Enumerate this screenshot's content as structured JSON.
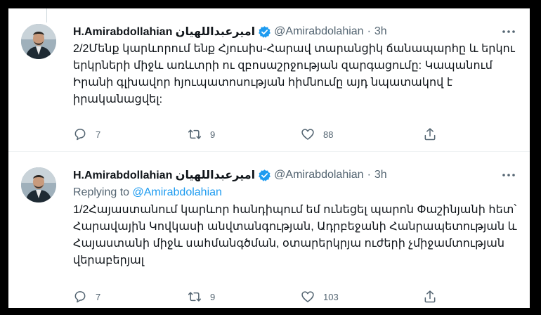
{
  "colors": {
    "accent": "#1d9bf0",
    "secondary_text": "#536471",
    "primary_text": "#0f1419"
  },
  "tweets": [
    {
      "name": "H.Amirabdollahian امیرعبداللهیان",
      "handle": "@Amirabdolahian",
      "separator": "·",
      "time": "3h",
      "replying_label": "",
      "replying_handle": "",
      "text": "2/2Մենք կարևորում ենք Հյուսիս-Հարավ տարանցիկ ճանապարհը և երկու երկրների միջև առևտրի ու զբոսաշրջության զարգացումը: Կապանում Իրանի գլխավոր հյուպատոսության հիմնումը այդ նպատակով է իրականացվել:",
      "replies": "7",
      "retweets": "9",
      "likes": "88"
    },
    {
      "name": "H.Amirabdollahian امیرعبداللهیان",
      "handle": "@Amirabdolahian",
      "separator": "·",
      "time": "3h",
      "replying_label": "Replying to ",
      "replying_handle": "@Amirabdolahian",
      "text": "1/2Հայաստանում կարևոր հանդիպում եմ ունեցել պարոն Փաշինյանի հետ՝ Հարավային Կովկասի անվտանգության, Ադրբեջանի Հանրապետության և Հայաստանի միջև սահմանգծման, օտարերկրյա ուժերի չմիջամտության վերաբերյալ",
      "replies": "7",
      "retweets": "9",
      "likes": "103"
    }
  ],
  "icons": {
    "verified": "verified-badge-icon",
    "more": "more-dots-icon",
    "reply": "reply-icon",
    "retweet": "retweet-icon",
    "like": "heart-icon",
    "share": "share-icon"
  }
}
